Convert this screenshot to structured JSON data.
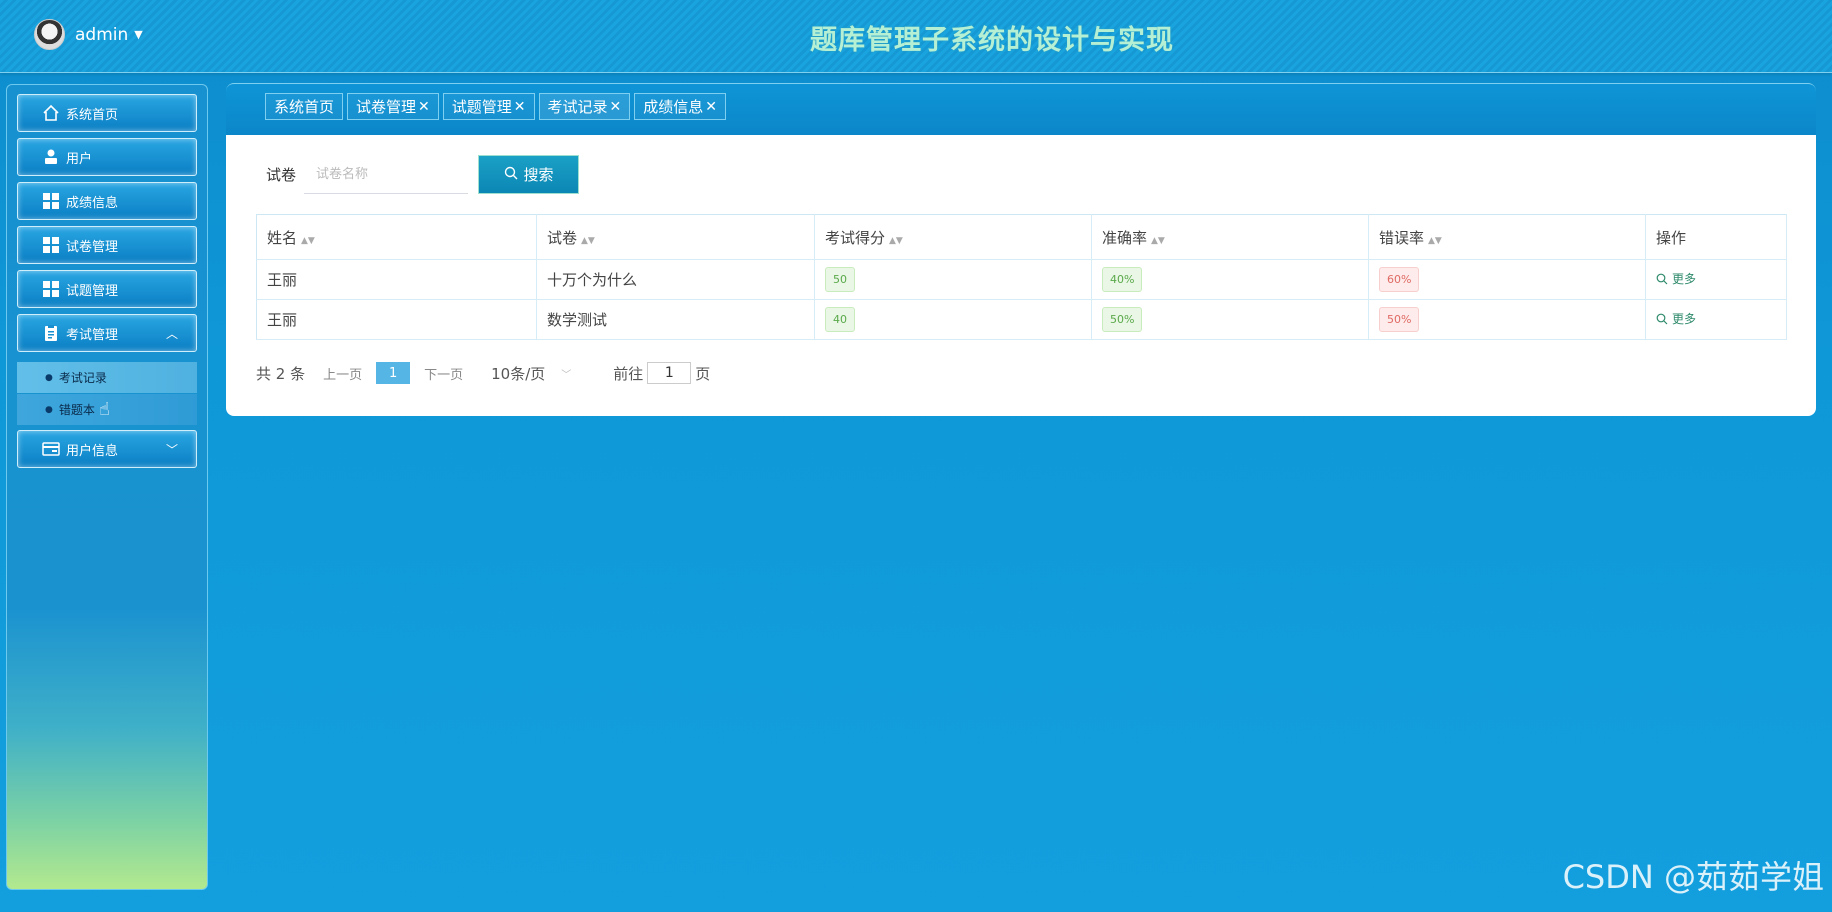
{
  "header": {
    "username": "admin",
    "title": "题库管理子系统的设计与实现"
  },
  "sidebar": {
    "items": [
      {
        "label": "系统首页",
        "icon": "home-icon"
      },
      {
        "label": "用户",
        "icon": "user-icon"
      },
      {
        "label": "成绩信息",
        "icon": "grid-icon"
      },
      {
        "label": "试卷管理",
        "icon": "grid-icon"
      },
      {
        "label": "试题管理",
        "icon": "grid-icon"
      },
      {
        "label": "考试管理",
        "icon": "clipboard-icon",
        "expanded": true
      },
      {
        "label": "用户信息",
        "icon": "card-icon",
        "expanded": false
      }
    ],
    "sub_items": [
      {
        "label": "考试记录"
      },
      {
        "label": "错题本"
      }
    ]
  },
  "tabs": [
    {
      "label": "系统首页",
      "closable": false
    },
    {
      "label": "试卷管理",
      "closable": true
    },
    {
      "label": "试题管理",
      "closable": true
    },
    {
      "label": "考试记录",
      "closable": true,
      "active": true
    },
    {
      "label": "成绩信息",
      "closable": true
    }
  ],
  "search": {
    "label": "试卷",
    "placeholder": "试卷名称",
    "button_label": "搜索"
  },
  "table": {
    "columns": [
      "姓名",
      "试卷",
      "考试得分",
      "准确率",
      "错误率",
      "操作"
    ],
    "rows": [
      {
        "name": "王丽",
        "paper": "十万个为什么",
        "score": "50",
        "accuracy": "40%",
        "error": "60%",
        "action": "更多"
      },
      {
        "name": "王丽",
        "paper": "数学测试",
        "score": "40",
        "accuracy": "50%",
        "error": "50%",
        "action": "更多"
      }
    ]
  },
  "pager": {
    "total": "共 2 条",
    "prev": "上一页",
    "current": "1",
    "next": "下一页",
    "page_size": "10条/页",
    "goto_prefix": "前往",
    "goto_value": "1",
    "goto_suffix": "页"
  },
  "watermark": "CSDN @茹茹学姐",
  "colors": {
    "background": "#0f98d8",
    "title": "#b6f0d4",
    "active_page": "#55b6e6",
    "tag_green": "#5aa94a",
    "tag_red": "#e06a64"
  }
}
